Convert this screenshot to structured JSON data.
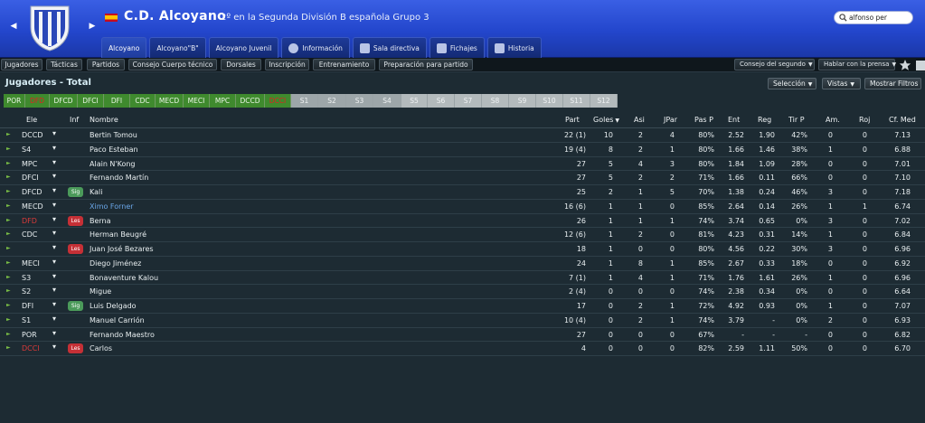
{
  "header": {
    "club_name": "C.D. Alcoyano",
    "subtitle": "2º en la Segunda División B española Grupo 3",
    "search_value": "alfonso per",
    "tabs": [
      "Alcoyano",
      "Alcoyano\"B\"",
      "Alcoyano Juvenil",
      "Información",
      "Sala directiva",
      "Fichajes",
      "Historia"
    ]
  },
  "subnav": {
    "items": [
      "Jugadores",
      "Tácticas",
      "Partidos",
      "Consejo Cuerpo técnico",
      "Dorsales",
      "Inscripción",
      "Entrenamiento",
      "Preparación para partido"
    ],
    "right": [
      "Consejo del segundo",
      "Hablar con la prensa"
    ]
  },
  "section": {
    "title": "Jugadores - Total",
    "buttons": [
      "Selección",
      "Vistas",
      "Mostrar Filtros"
    ]
  },
  "positions": [
    "POR",
    "DFD",
    "DFCD",
    "DFCI",
    "DFI",
    "CDC",
    "MECD",
    "MECI",
    "MPC",
    "DCCD",
    "DCCI",
    "S1",
    "S2",
    "S3",
    "S4",
    "S5",
    "S6",
    "S7",
    "S8",
    "S9",
    "S10",
    "S11",
    "S12"
  ],
  "table": {
    "columns": [
      "Ele",
      "Inf",
      "Nombre",
      "Part",
      "Goles",
      "Asi",
      "JPar",
      "Pas P",
      "Ent",
      "Reg",
      "Tir P",
      "Am.",
      "Roj",
      "Cf. Med"
    ],
    "rows": [
      {
        "ele": "DCCD",
        "inf": "",
        "name": "Bertin Tomou",
        "part": "22 (1)",
        "goles": "10",
        "asi": "2",
        "jpar": "4",
        "pasp": "80%",
        "ent": "2.52",
        "reg": "1.90",
        "tirp": "42%",
        "am": "0",
        "roj": "0",
        "cf": "7.13"
      },
      {
        "ele": "S4",
        "inf": "",
        "name": "Paco Esteban",
        "part": "19 (4)",
        "goles": "8",
        "asi": "2",
        "jpar": "1",
        "pasp": "80%",
        "ent": "1.66",
        "reg": "1.46",
        "tirp": "38%",
        "am": "1",
        "roj": "0",
        "cf": "6.88"
      },
      {
        "ele": "MPC",
        "inf": "",
        "name": "Alain N'Kong",
        "part": "27",
        "goles": "5",
        "asi": "4",
        "jpar": "3",
        "pasp": "80%",
        "ent": "1.84",
        "reg": "1.09",
        "tirp": "28%",
        "am": "0",
        "roj": "0",
        "cf": "7.01"
      },
      {
        "ele": "DFCI",
        "inf": "",
        "name": "Fernando Martín",
        "part": "27",
        "goles": "5",
        "asi": "2",
        "jpar": "2",
        "pasp": "71%",
        "ent": "1.66",
        "reg": "0.11",
        "tirp": "66%",
        "am": "0",
        "roj": "0",
        "cf": "7.10"
      },
      {
        "ele": "DFCD",
        "inf": "Sig",
        "name": "Kali",
        "part": "25",
        "goles": "2",
        "asi": "1",
        "jpar": "5",
        "pasp": "70%",
        "ent": "1.38",
        "reg": "0.24",
        "tirp": "46%",
        "am": "3",
        "roj": "0",
        "cf": "7.18"
      },
      {
        "ele": "MECD",
        "inf": "",
        "name": "Ximo Forner",
        "part": "16 (6)",
        "goles": "1",
        "asi": "1",
        "jpar": "0",
        "pasp": "85%",
        "ent": "2.64",
        "reg": "0.14",
        "tirp": "26%",
        "am": "1",
        "roj": "1",
        "cf": "6.74"
      },
      {
        "ele": "DFD",
        "inf": "Les",
        "name": "Berna",
        "part": "26",
        "goles": "1",
        "asi": "1",
        "jpar": "1",
        "pasp": "74%",
        "ent": "3.74",
        "reg": "0.65",
        "tirp": "0%",
        "am": "3",
        "roj": "0",
        "cf": "7.02"
      },
      {
        "ele": "CDC",
        "inf": "",
        "name": "Herman Beugré",
        "part": "12 (6)",
        "goles": "1",
        "asi": "2",
        "jpar": "0",
        "pasp": "81%",
        "ent": "4.23",
        "reg": "0.31",
        "tirp": "14%",
        "am": "1",
        "roj": "0",
        "cf": "6.84"
      },
      {
        "ele": "",
        "inf": "Les",
        "name": "Juan José Bezares",
        "part": "18",
        "goles": "1",
        "asi": "0",
        "jpar": "0",
        "pasp": "80%",
        "ent": "4.56",
        "reg": "0.22",
        "tirp": "30%",
        "am": "3",
        "roj": "0",
        "cf": "6.96"
      },
      {
        "ele": "MECI",
        "inf": "",
        "name": "Diego Jiménez",
        "part": "24",
        "goles": "1",
        "asi": "8",
        "jpar": "1",
        "pasp": "85%",
        "ent": "2.67",
        "reg": "0.33",
        "tirp": "18%",
        "am": "0",
        "roj": "0",
        "cf": "6.92"
      },
      {
        "ele": "S3",
        "inf": "",
        "name": "Bonaventure Kalou",
        "part": "7 (1)",
        "goles": "1",
        "asi": "4",
        "jpar": "1",
        "pasp": "71%",
        "ent": "1.76",
        "reg": "1.61",
        "tirp": "26%",
        "am": "1",
        "roj": "0",
        "cf": "6.96"
      },
      {
        "ele": "S2",
        "inf": "",
        "name": "Migue",
        "part": "2 (4)",
        "goles": "0",
        "asi": "0",
        "jpar": "0",
        "pasp": "74%",
        "ent": "2.38",
        "reg": "0.34",
        "tirp": "0%",
        "am": "0",
        "roj": "0",
        "cf": "6.64"
      },
      {
        "ele": "DFI",
        "inf": "Sig",
        "name": "Luis Delgado",
        "part": "17",
        "goles": "0",
        "asi": "2",
        "jpar": "1",
        "pasp": "72%",
        "ent": "4.92",
        "reg": "0.93",
        "tirp": "0%",
        "am": "1",
        "roj": "0",
        "cf": "7.07"
      },
      {
        "ele": "S1",
        "inf": "",
        "name": "Manuel Carrión",
        "part": "10 (4)",
        "goles": "0",
        "asi": "2",
        "jpar": "1",
        "pasp": "74%",
        "ent": "3.79",
        "reg": "-",
        "tirp": "0%",
        "am": "2",
        "roj": "0",
        "cf": "6.93"
      },
      {
        "ele": "POR",
        "inf": "",
        "name": "Fernando Maestro",
        "part": "27",
        "goles": "0",
        "asi": "0",
        "jpar": "0",
        "pasp": "67%",
        "ent": "-",
        "reg": "-",
        "tirp": "-",
        "am": "0",
        "roj": "0",
        "cf": "6.82"
      },
      {
        "ele": "DCCI",
        "inf": "Les",
        "name": "Carlos",
        "part": "4",
        "goles": "0",
        "asi": "0",
        "jpar": "0",
        "pasp": "82%",
        "ent": "2.59",
        "reg": "1.11",
        "tirp": "50%",
        "am": "0",
        "roj": "0",
        "cf": "6.70"
      }
    ]
  },
  "colors": {
    "header_blue": "#2346cc",
    "position_green": "#3f8a2e",
    "injury_red": "#c53036",
    "signing_green": "#4b9a5a"
  },
  "icons": [
    "crest-icon",
    "search-icon",
    "info-icon",
    "board-icon",
    "transfers-icon",
    "history-icon",
    "star-icon",
    "document-icon"
  ]
}
